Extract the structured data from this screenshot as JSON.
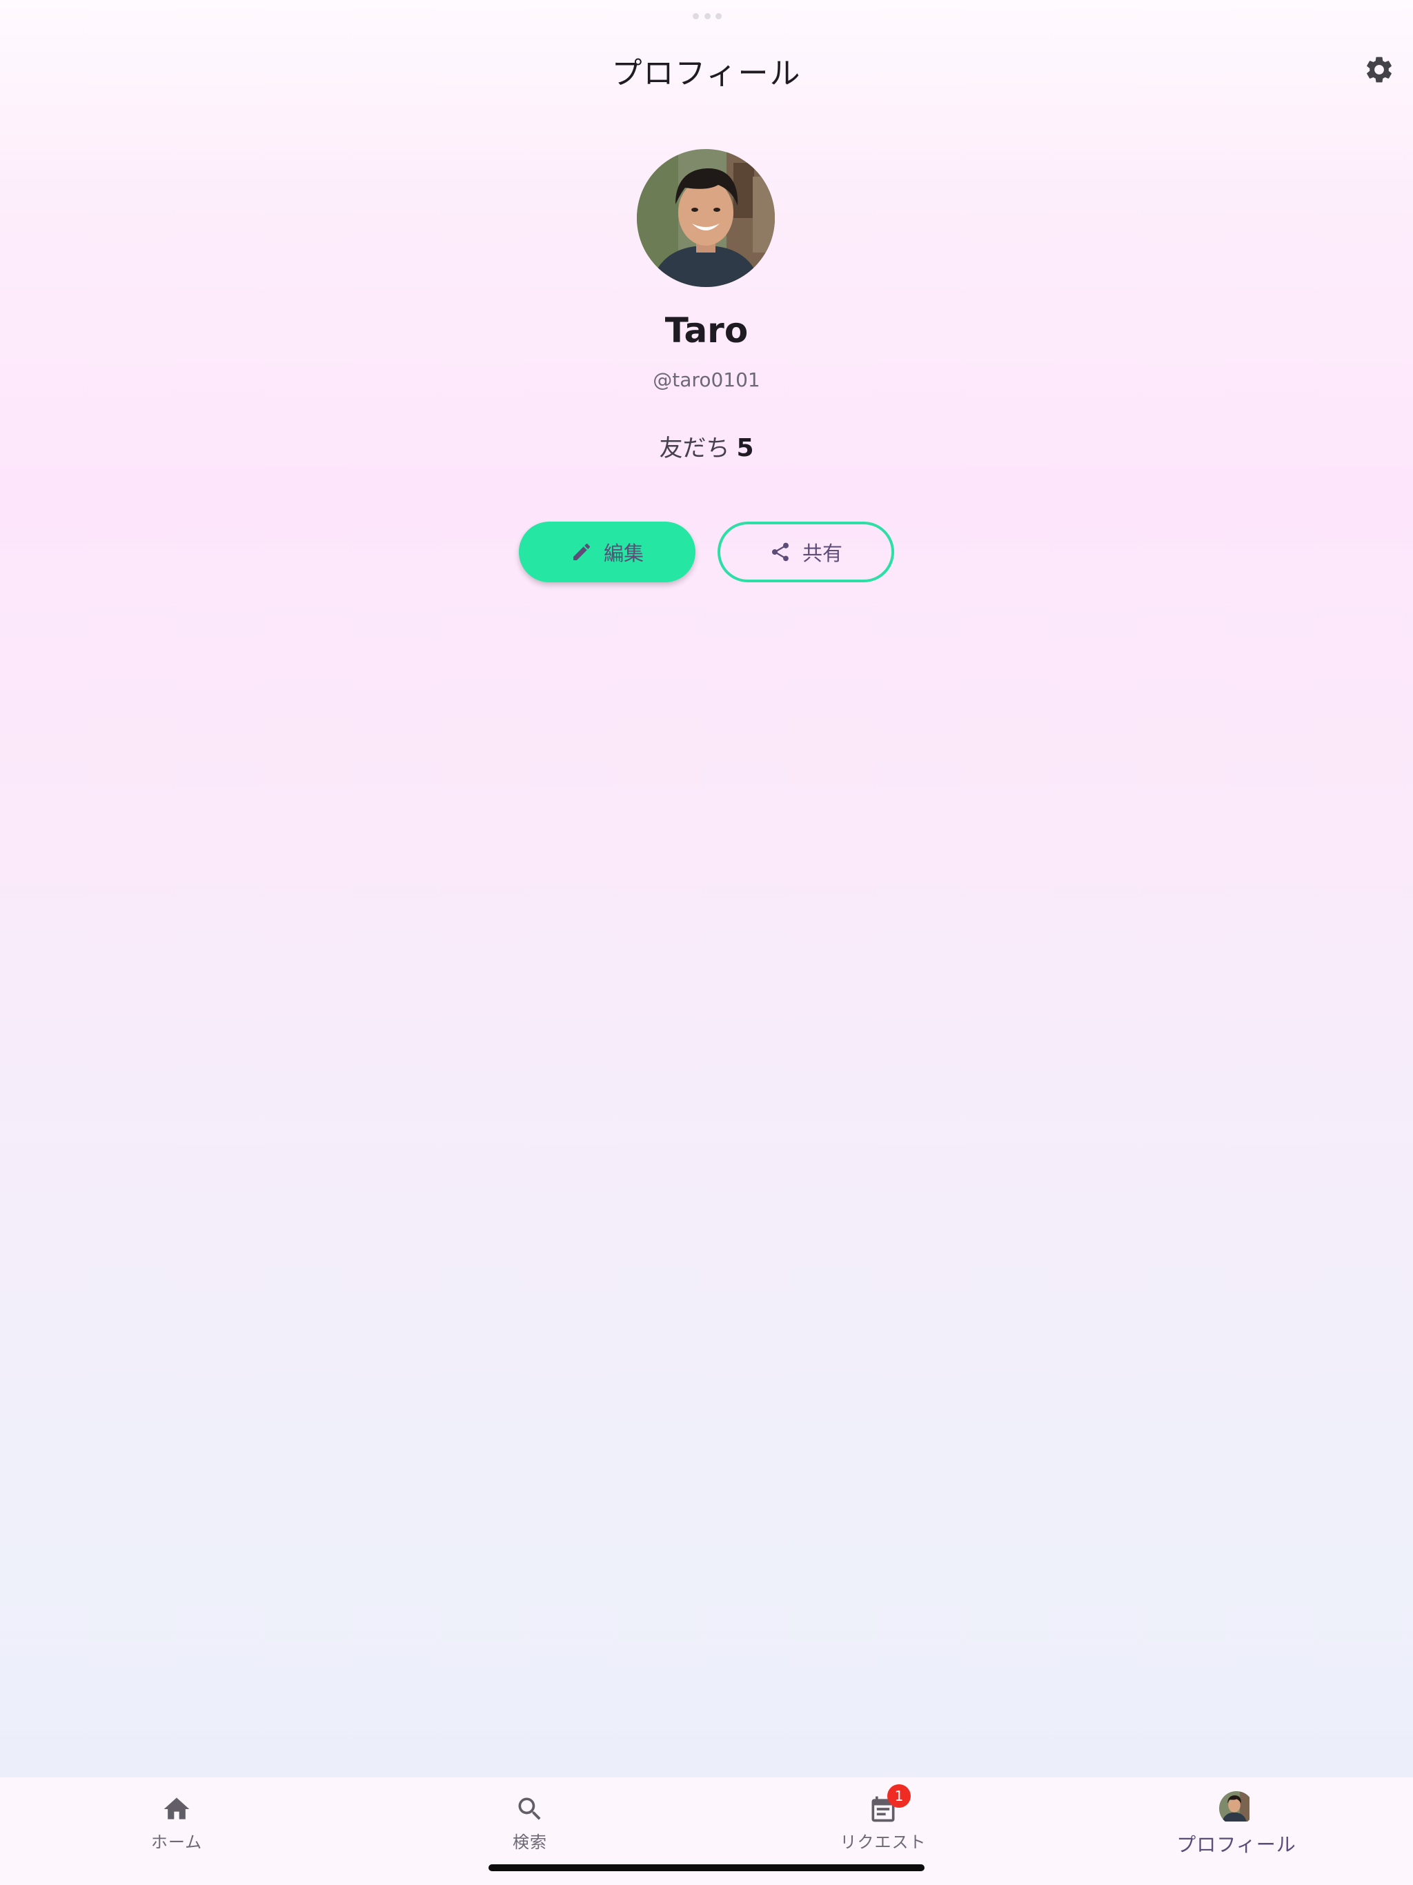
{
  "header": {
    "title": "プロフィール",
    "settings_icon": "gear-icon"
  },
  "profile": {
    "name": "Taro",
    "handle": "@taro0101",
    "friends_label": "友だち",
    "friends_count": "5"
  },
  "actions": {
    "edit_label": "編集",
    "edit_icon": "pencil-icon",
    "share_label": "共有",
    "share_icon": "share-icon"
  },
  "tabbar": {
    "items": [
      {
        "label": "ホーム",
        "icon": "home-icon"
      },
      {
        "label": "検索",
        "icon": "search-icon"
      },
      {
        "label": "リクエスト",
        "icon": "calendar-icon",
        "badge": "1"
      },
      {
        "label": "プロフィール",
        "icon": "avatar",
        "active": true
      }
    ]
  },
  "colors": {
    "accent_green": "#25e6a2",
    "accent_purple": "#5d4b78",
    "badge_red": "#ef2c24"
  }
}
